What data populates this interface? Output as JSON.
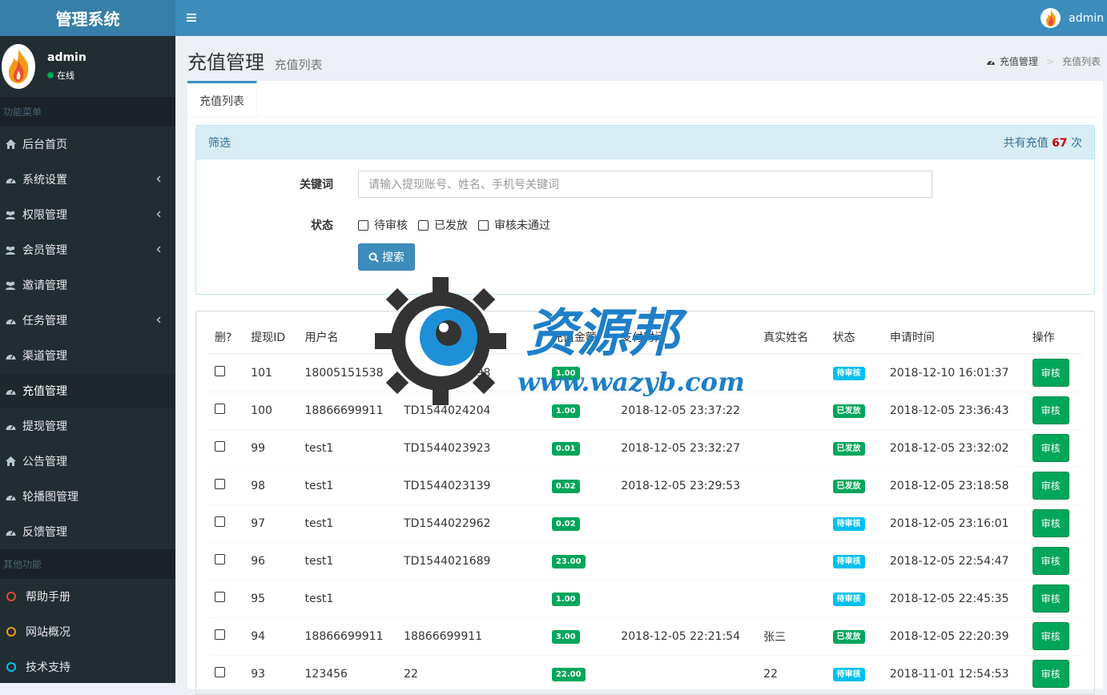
{
  "app": {
    "title": "管理系统"
  },
  "user": {
    "name": "admin",
    "status": "在线"
  },
  "sidebar": {
    "header1": "功能菜单",
    "items": [
      {
        "label": "后台首页",
        "icon": "home-icon",
        "chevron": false,
        "active": false
      },
      {
        "label": "系统设置",
        "icon": "dashboard-icon",
        "chevron": true,
        "active": false
      },
      {
        "label": "权限管理",
        "icon": "users-icon",
        "chevron": true,
        "active": false
      },
      {
        "label": "会员管理",
        "icon": "users-icon",
        "chevron": true,
        "active": false
      },
      {
        "label": "邀请管理",
        "icon": "users-icon",
        "chevron": false,
        "active": false
      },
      {
        "label": "任务管理",
        "icon": "dashboard-icon",
        "chevron": true,
        "active": false
      },
      {
        "label": "渠道管理",
        "icon": "dashboard-icon",
        "chevron": false,
        "active": false
      },
      {
        "label": "充值管理",
        "icon": "dashboard-icon",
        "chevron": false,
        "active": true
      },
      {
        "label": "提现管理",
        "icon": "dashboard-icon",
        "chevron": false,
        "active": false
      },
      {
        "label": "公告管理",
        "icon": "home-icon",
        "chevron": false,
        "active": false
      },
      {
        "label": "轮播图管理",
        "icon": "dashboard-icon",
        "chevron": false,
        "active": false
      },
      {
        "label": "反馈管理",
        "icon": "dashboard-icon",
        "chevron": false,
        "active": false
      }
    ],
    "header2": "其他功能",
    "others": [
      {
        "label": "帮助手册",
        "color": "#dd4b39"
      },
      {
        "label": "网站概况",
        "color": "#f39c12"
      },
      {
        "label": "技术支持",
        "color": "#00c0ef"
      }
    ]
  },
  "topbar": {
    "user": "admin"
  },
  "page": {
    "title": "充值管理",
    "subtitle": "充值列表"
  },
  "breadcrumb": {
    "home": "充值管理",
    "current": "充值列表"
  },
  "tab": {
    "label": "充值列表"
  },
  "filter": {
    "title": "筛选",
    "count_prefix": "共有充值",
    "count": "67",
    "count_suffix": "次",
    "keyword_label": "关键词",
    "keyword_placeholder": "请输入提现账号、姓名、手机号关键词",
    "status_label": "状态",
    "status_options": [
      "待审核",
      "已发放",
      "审核未通过"
    ],
    "search_button": "搜索"
  },
  "table": {
    "headers": [
      "删?",
      "提现ID",
      "用户名",
      "账号",
      "充值金额",
      "支付时间",
      "真实姓名",
      "状态",
      "申请时间",
      "操作"
    ],
    "rows": [
      {
        "id": "101",
        "username": "18005151538",
        "account": "TD1544428898",
        "amount": "1.00",
        "paytime": "",
        "realname": "",
        "status": "待审核",
        "status_color": "#00c0ef",
        "applytime": "2018-12-10 16:01:37",
        "op": "审核"
      },
      {
        "id": "100",
        "username": "18866699911",
        "account": "TD1544024204",
        "amount": "1.00",
        "paytime": "2018-12-05 23:37:22",
        "realname": "",
        "status": "已发放",
        "status_color": "#00a65a",
        "applytime": "2018-12-05 23:36:43",
        "op": "审核"
      },
      {
        "id": "99",
        "username": "test1",
        "account": "TD1544023923",
        "amount": "0.01",
        "paytime": "2018-12-05 23:32:27",
        "realname": "",
        "status": "已发放",
        "status_color": "#00a65a",
        "applytime": "2018-12-05 23:32:02",
        "op": "审核"
      },
      {
        "id": "98",
        "username": "test1",
        "account": "TD1544023139",
        "amount": "0.02",
        "paytime": "2018-12-05 23:29:53",
        "realname": "",
        "status": "已发放",
        "status_color": "#00a65a",
        "applytime": "2018-12-05 23:18:58",
        "op": "审核"
      },
      {
        "id": "97",
        "username": "test1",
        "account": "TD1544022962",
        "amount": "0.02",
        "paytime": "",
        "realname": "",
        "status": "待审核",
        "status_color": "#00c0ef",
        "applytime": "2018-12-05 23:16:01",
        "op": "审核"
      },
      {
        "id": "96",
        "username": "test1",
        "account": "TD1544021689",
        "amount": "23.00",
        "paytime": "",
        "realname": "",
        "status": "待审核",
        "status_color": "#00c0ef",
        "applytime": "2018-12-05 22:54:47",
        "op": "审核"
      },
      {
        "id": "95",
        "username": "test1",
        "account": "",
        "amount": "1.00",
        "paytime": "",
        "realname": "",
        "status": "待审核",
        "status_color": "#00c0ef",
        "applytime": "2018-12-05 22:45:35",
        "op": "审核"
      },
      {
        "id": "94",
        "username": "18866699911",
        "account": "18866699911",
        "amount": "3.00",
        "paytime": "2018-12-05 22:21:54",
        "realname": "张三",
        "status": "已发放",
        "status_color": "#00a65a",
        "applytime": "2018-12-05 22:20:39",
        "op": "审核"
      },
      {
        "id": "93",
        "username": "123456",
        "account": "22",
        "amount": "22.00",
        "paytime": "",
        "realname": "22",
        "status": "待审核",
        "status_color": "#00c0ef",
        "applytime": "2018-11-01 12:54:53",
        "op": "审核"
      }
    ]
  },
  "watermark": {
    "text_cn": "资源邦",
    "text_url": "www.wazyb.com"
  }
}
